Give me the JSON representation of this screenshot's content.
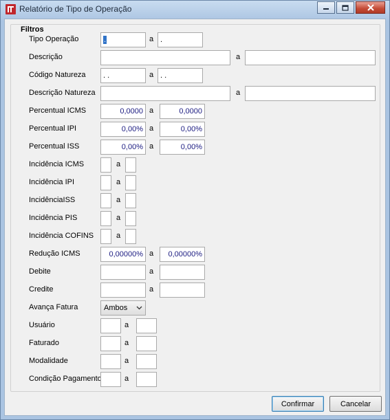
{
  "window": {
    "title": "Relatório de Tipo de Operação"
  },
  "filters": {
    "legend": "Filtros",
    "tipo_operacao": {
      "label": "Tipo Operação",
      "from": ".",
      "sep": "a",
      "to": "."
    },
    "descricao": {
      "label": "Descrição",
      "from": "",
      "sep": "a",
      "to": ""
    },
    "codigo_natureza": {
      "label": "Código Natureza",
      "from": ". .",
      "sep": "a",
      "to": ". ."
    },
    "descricao_natureza": {
      "label": "Descrição Natureza",
      "from": "",
      "sep": "a",
      "to": ""
    },
    "percentual_icms": {
      "label": "Percentual ICMS",
      "from": "0,0000",
      "sep": "a",
      "to": "0,0000"
    },
    "percentual_ipi": {
      "label": "Percentual IPI",
      "from": "0,00%",
      "sep": "a",
      "to": "0,00%"
    },
    "percentual_iss": {
      "label": "Percentual ISS",
      "from": "0,00%",
      "sep": "a",
      "to": "0,00%"
    },
    "incidencia_icms": {
      "label": "Incidência ICMS",
      "from": "",
      "sep": "a",
      "to": ""
    },
    "incidencia_ipi": {
      "label": "Incidência IPI",
      "from": "",
      "sep": "a",
      "to": ""
    },
    "incidencia_iss": {
      "label": "IncidênciaISS",
      "from": "",
      "sep": "a",
      "to": ""
    },
    "incidencia_pis": {
      "label": "Incidência PIS",
      "from": "",
      "sep": "a",
      "to": ""
    },
    "incidencia_cofins": {
      "label": "Incidência COFINS",
      "from": "",
      "sep": "a",
      "to": ""
    },
    "reducao_icms": {
      "label": "Redução ICMS",
      "from": "0,00000%",
      "sep": "a",
      "to": "0,00000%"
    },
    "debite": {
      "label": "Debite",
      "from": "",
      "sep": "a",
      "to": ""
    },
    "credite": {
      "label": "Credite",
      "from": "",
      "sep": "a",
      "to": ""
    },
    "avanca_fatura": {
      "label": "Avança Fatura",
      "selected": "Ambos"
    },
    "usuario": {
      "label": "Usuário",
      "from": "",
      "sep": "a",
      "to": ""
    },
    "faturado": {
      "label": "Faturado",
      "from": "",
      "sep": "a",
      "to": ""
    },
    "modalidade": {
      "label": "Modalidade",
      "from": "",
      "sep": "a",
      "to": ""
    },
    "condicao_pagamento": {
      "label": "Condição Pagamento",
      "from": "",
      "sep": "a",
      "to": ""
    }
  },
  "buttons": {
    "confirm": "Confirmar",
    "cancel": "Cancelar"
  },
  "icons": {
    "app": "app-logo-icon",
    "minimize": "minimize-icon",
    "maximize": "maximize-icon",
    "close": "close-icon",
    "dropdown": "chevron-down-icon"
  },
  "colors": {
    "accent": "#3174c8",
    "close_button": "#c44a35",
    "numeric_text": "#1a1a80"
  }
}
